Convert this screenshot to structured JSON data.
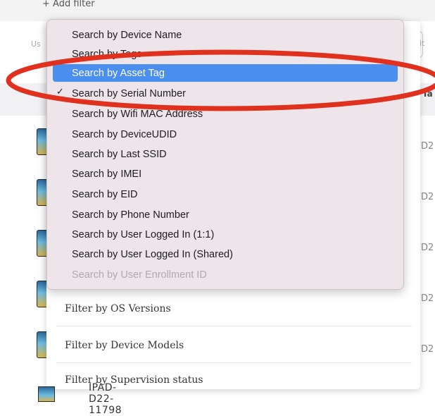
{
  "header": {
    "add_filter": "+ Add filter"
  },
  "background": {
    "left_fragment": "Us",
    "right_fragment": "it",
    "column_label": "Ta",
    "row_right_values": [
      "D2",
      "D2",
      "D2",
      "D2",
      "D2"
    ]
  },
  "search_menu": {
    "items": [
      {
        "label": "Search by Device Name",
        "state": "normal"
      },
      {
        "label": "Search by Tags",
        "state": "normal"
      },
      {
        "label": "Search by Asset Tag",
        "state": "highlighted"
      },
      {
        "label": "Search by Serial Number",
        "state": "checked"
      },
      {
        "label": "Search by Wifi MAC Address",
        "state": "normal"
      },
      {
        "label": "Search by DeviceUDID",
        "state": "normal"
      },
      {
        "label": "Search by Last SSID",
        "state": "normal"
      },
      {
        "label": "Search by IMEI",
        "state": "normal"
      },
      {
        "label": "Search by EID",
        "state": "normal"
      },
      {
        "label": "Search by Phone Number",
        "state": "normal"
      },
      {
        "label": "Search by User Logged In (1:1)",
        "state": "normal"
      },
      {
        "label": "Search by User Logged In (Shared)",
        "state": "normal"
      },
      {
        "label": "Search by User Enrollment ID",
        "state": "disabled"
      }
    ],
    "check_glyph": "✓"
  },
  "filter_list": {
    "items": [
      "Filter by OS Versions",
      "Filter by Device Models",
      "Filter by Supervision status"
    ]
  },
  "bottom_row": {
    "label": "IPAD-D22-11798"
  },
  "colors": {
    "highlight": "#4a8ff0",
    "annotation": "#e0301e",
    "menu_bg": "#ede5e9"
  }
}
